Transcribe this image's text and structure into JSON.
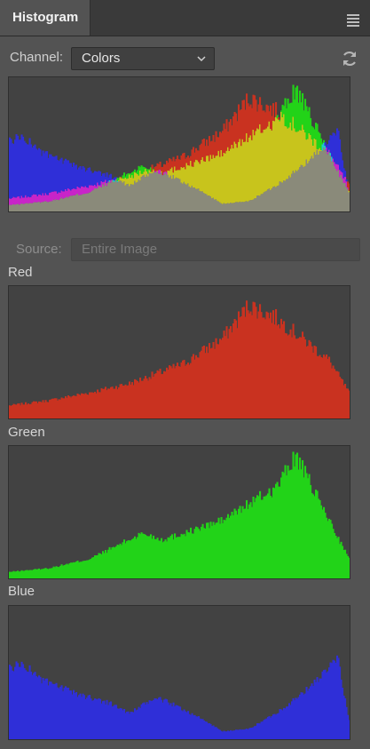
{
  "panel": {
    "tab_title": "Histogram",
    "menu_icon": "panel-menu-icon"
  },
  "controls": {
    "channel_label": "Channel:",
    "channel_value": "Colors",
    "refresh_icon": "refresh-icon",
    "source_label": "Source:",
    "source_value": "Entire Image"
  },
  "sections": {
    "red_label": "Red",
    "green_label": "Green",
    "blue_label": "Blue"
  },
  "colors": {
    "red": "#c93220",
    "green": "#22d318",
    "blue": "#2f2fd8",
    "yellow": "#c8c41c",
    "magenta": "#c824c8",
    "cyan": "#22c8c8",
    "overlap_gray": "#8a8a7a"
  }
}
